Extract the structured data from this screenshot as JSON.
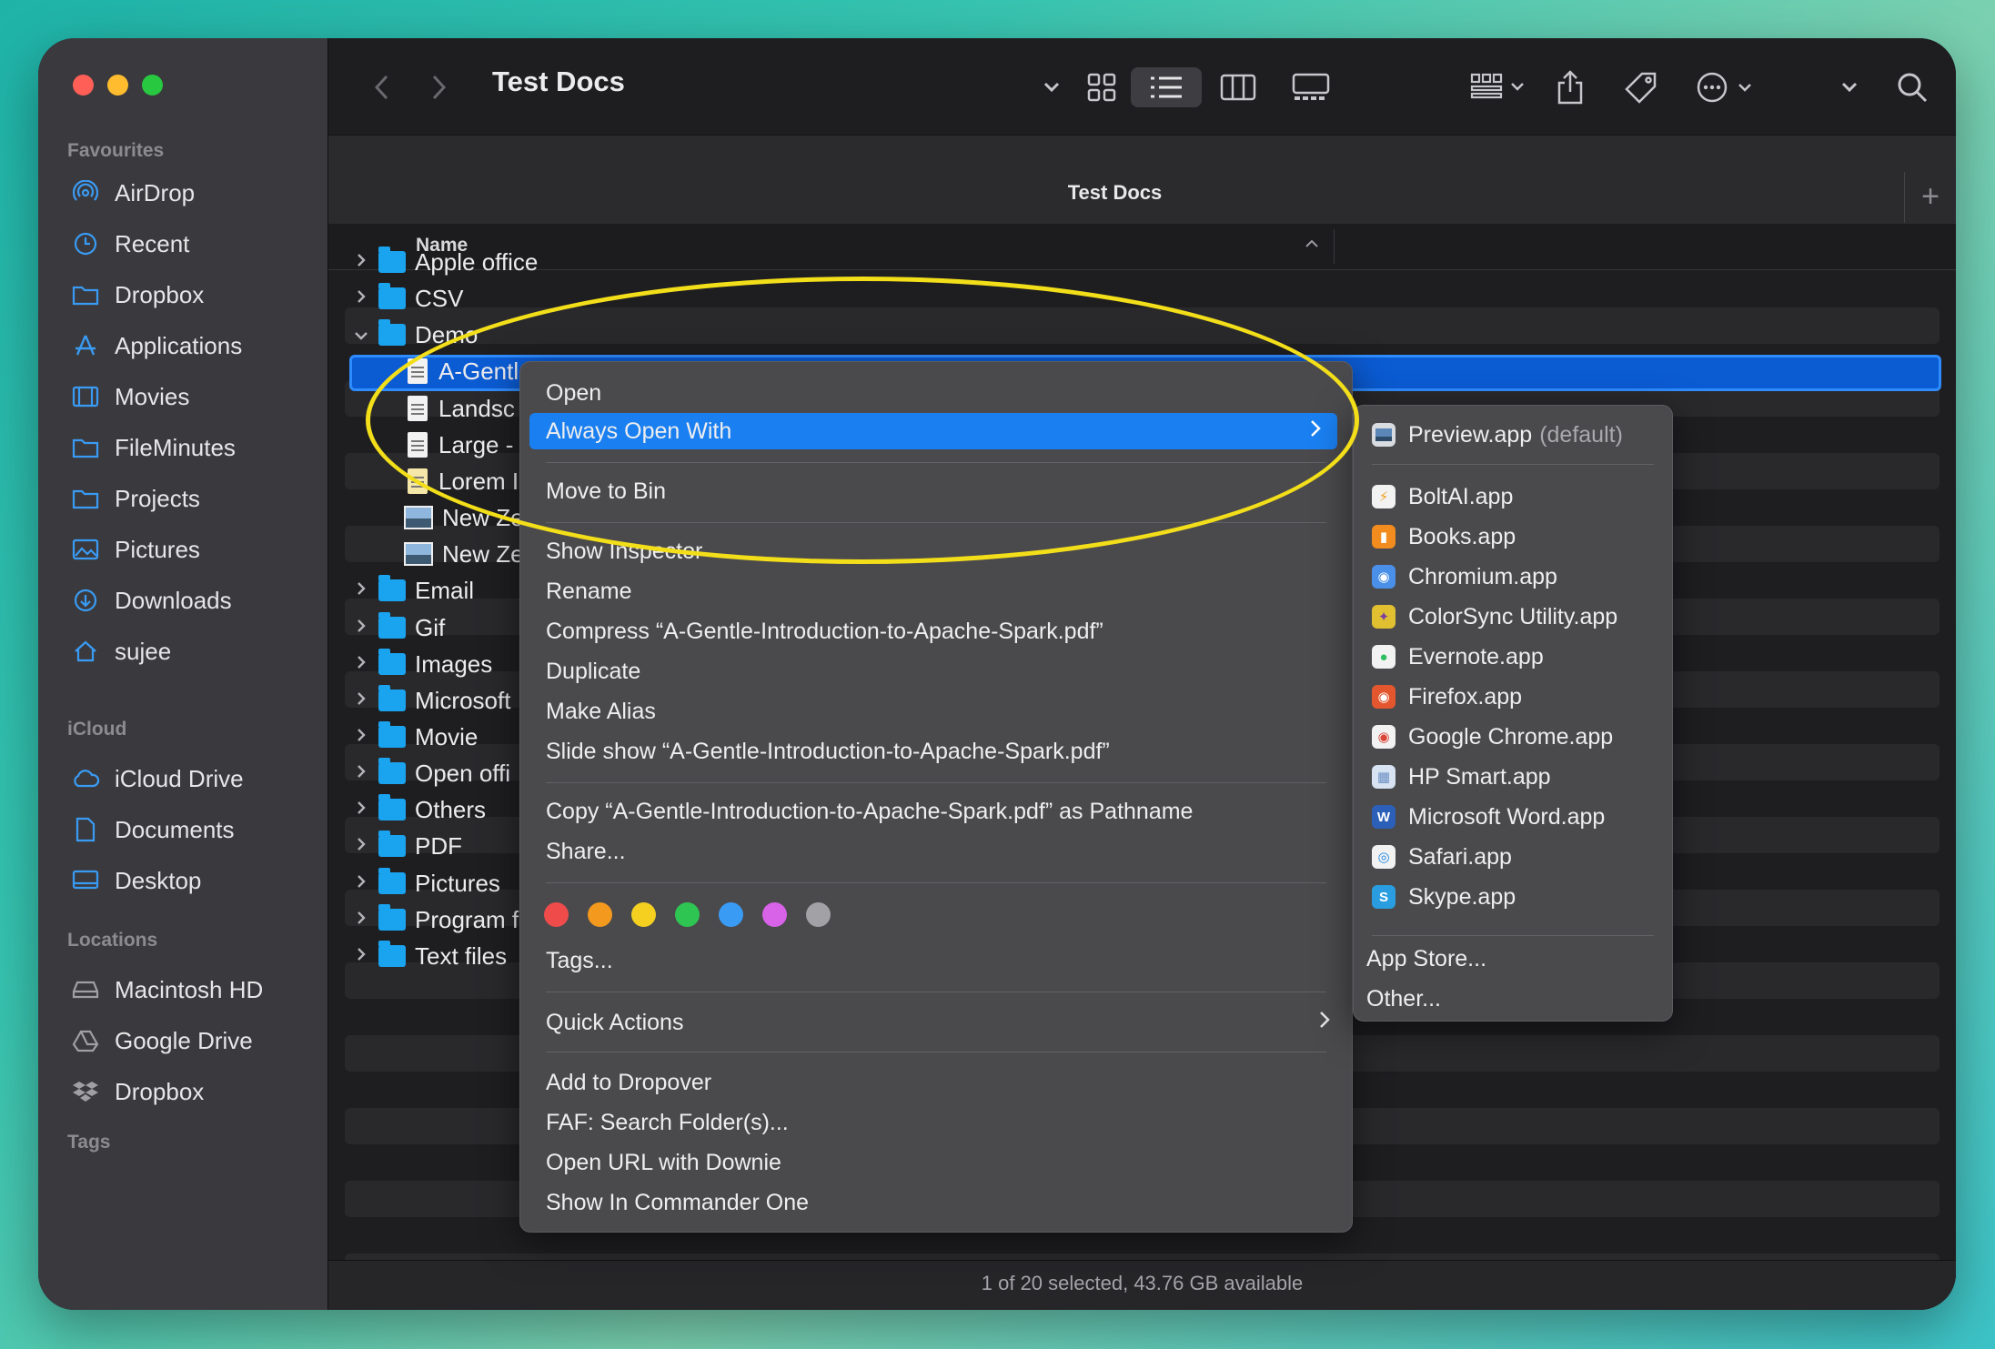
{
  "window": {
    "title": "Test Docs",
    "tab_title": "Test Docs",
    "new_tab": "+"
  },
  "sidebar": {
    "favourites_label": "Favourites",
    "favourites": [
      {
        "label": "AirDrop",
        "icon": "airdrop-icon"
      },
      {
        "label": "Recent",
        "icon": "clock-icon"
      },
      {
        "label": "Dropbox",
        "icon": "folder-icon"
      },
      {
        "label": "Applications",
        "icon": "applications-icon"
      },
      {
        "label": "Movies",
        "icon": "film-icon"
      },
      {
        "label": "FileMinutes",
        "icon": "folder-icon"
      },
      {
        "label": "Projects",
        "icon": "folder-icon"
      },
      {
        "label": "Pictures",
        "icon": "photo-icon"
      },
      {
        "label": "Downloads",
        "icon": "download-icon"
      },
      {
        "label": "sujee",
        "icon": "home-icon"
      }
    ],
    "icloud_label": "iCloud",
    "icloud": [
      {
        "label": "iCloud Drive",
        "icon": "cloud-icon"
      },
      {
        "label": "Documents",
        "icon": "document-icon"
      },
      {
        "label": "Desktop",
        "icon": "desktop-icon"
      }
    ],
    "locations_label": "Locations",
    "locations": [
      {
        "label": "Macintosh HD",
        "icon": "disk-icon"
      },
      {
        "label": "Google Drive",
        "icon": "drive-icon"
      },
      {
        "label": "Dropbox",
        "icon": "dropbox-icon"
      }
    ],
    "tags_label": "Tags"
  },
  "list": {
    "column_name": "Name",
    "items": [
      {
        "label": "Apple office",
        "type": "folder",
        "expanded": false
      },
      {
        "label": "CSV",
        "type": "folder",
        "expanded": false
      },
      {
        "label": "Demo",
        "type": "folder",
        "expanded": true
      },
      {
        "label": "A-Gentl",
        "type": "pdf",
        "selected": true
      },
      {
        "label": "Landsc",
        "type": "pdf"
      },
      {
        "label": "Large -",
        "type": "pdf"
      },
      {
        "label": "Lorem I",
        "type": "doc"
      },
      {
        "label": "New Ze",
        "type": "image"
      },
      {
        "label": "New Ze",
        "type": "image"
      },
      {
        "label": "Email",
        "type": "folder",
        "expanded": false
      },
      {
        "label": "Gif",
        "type": "folder",
        "expanded": false
      },
      {
        "label": "Images",
        "type": "folder",
        "expanded": false
      },
      {
        "label": "Microsoft",
        "type": "folder",
        "expanded": false
      },
      {
        "label": "Movie",
        "type": "folder",
        "expanded": false
      },
      {
        "label": "Open offi",
        "type": "folder",
        "expanded": false
      },
      {
        "label": "Others",
        "type": "folder",
        "expanded": false
      },
      {
        "label": "PDF",
        "type": "folder",
        "expanded": false
      },
      {
        "label": "Pictures",
        "type": "folder",
        "expanded": false
      },
      {
        "label": "Program f",
        "type": "folder",
        "expanded": false
      },
      {
        "label": "Text files",
        "type": "folder",
        "expanded": false
      }
    ]
  },
  "context_menu": {
    "open": "Open",
    "always_open_with": "Always Open With",
    "move_to_bin": "Move to Bin",
    "show_inspector": "Show Inspector",
    "rename": "Rename",
    "compress": "Compress “A-Gentle-Introduction-to-Apache-Spark.pdf”",
    "duplicate": "Duplicate",
    "make_alias": "Make Alias",
    "slide_show": "Slide show “A-Gentle-Introduction-to-Apache-Spark.pdf”",
    "copy_pathname": "Copy “A-Gentle-Introduction-to-Apache-Spark.pdf” as Pathname",
    "share": "Share...",
    "tag_colors": [
      "#ef4b4b",
      "#f39a1e",
      "#f5d020",
      "#2fc552",
      "#3a9bf4",
      "#d863e8",
      "#a2a2a6"
    ],
    "tags": "Tags...",
    "quick_actions": "Quick Actions",
    "add_to_dropover": "Add to Dropover",
    "faf_search": "FAF: Search Folder(s)...",
    "open_url_downie": "Open URL with Downie",
    "show_commander": "Show In Commander One"
  },
  "submenu": {
    "default_app": "Preview.app",
    "default_suffix": "(default)",
    "apps": [
      {
        "label": "BoltAI.app",
        "icon": "boltai-icon",
        "color": "#f2f2f2"
      },
      {
        "label": "Books.app",
        "icon": "books-icon",
        "color": "#f28c1e"
      },
      {
        "label": "Chromium.app",
        "icon": "chromium-icon",
        "color": "#4a8fe8"
      },
      {
        "label": "ColorSync Utility.app",
        "icon": "colorsync-icon",
        "color": "#e0c030"
      },
      {
        "label": "Evernote.app",
        "icon": "evernote-icon",
        "color": "#f2f2f2"
      },
      {
        "label": "Firefox.app",
        "icon": "firefox-icon",
        "color": "#e4572e"
      },
      {
        "label": "Google Chrome.app",
        "icon": "chrome-icon",
        "color": "#f2f2f2"
      },
      {
        "label": "HP Smart.app",
        "icon": "hp-smart-icon",
        "color": "#d7e3f2"
      },
      {
        "label": "Microsoft Word.app",
        "icon": "word-icon",
        "color": "#2b5fb8"
      },
      {
        "label": "Safari.app",
        "icon": "safari-icon",
        "color": "#f2f2f2"
      },
      {
        "label": "Skype.app",
        "icon": "skype-icon",
        "color": "#2a9de0"
      }
    ],
    "app_store": "App Store...",
    "other": "Other..."
  },
  "status": {
    "text": "1 of 20 selected, 43.76 GB available"
  }
}
